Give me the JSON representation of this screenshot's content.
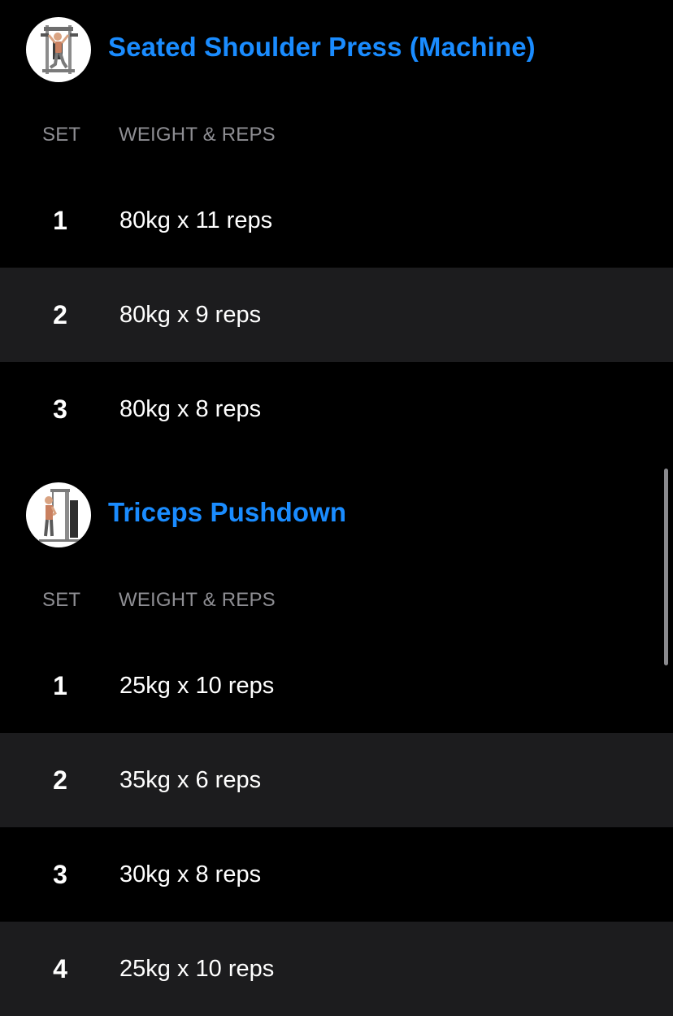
{
  "colors": {
    "background": "#000000",
    "row_alt": "#1c1c1e",
    "title_accent": "#1a8cff",
    "header_text": "#8e8e93",
    "value_text": "#ffffff",
    "scrollbar": "#8a8a8e"
  },
  "exercises": [
    {
      "title": "Seated Shoulder Press (Machine)",
      "thumbnail_icon": "shoulder-press-machine-icon",
      "col_set": "SET",
      "col_weight_reps": "WEIGHT & REPS",
      "sets": [
        {
          "set": "1",
          "value": "80kg x 11 reps"
        },
        {
          "set": "2",
          "value": "80kg x 9 reps"
        },
        {
          "set": "3",
          "value": "80kg x 8 reps"
        }
      ]
    },
    {
      "title": "Triceps Pushdown",
      "thumbnail_icon": "cable-pushdown-icon",
      "col_set": "SET",
      "col_weight_reps": "WEIGHT & REPS",
      "sets": [
        {
          "set": "1",
          "value": "25kg x 10 reps"
        },
        {
          "set": "2",
          "value": "35kg x 6 reps"
        },
        {
          "set": "3",
          "value": "30kg x 8 reps"
        },
        {
          "set": "4",
          "value": "25kg x 10 reps"
        }
      ]
    }
  ]
}
